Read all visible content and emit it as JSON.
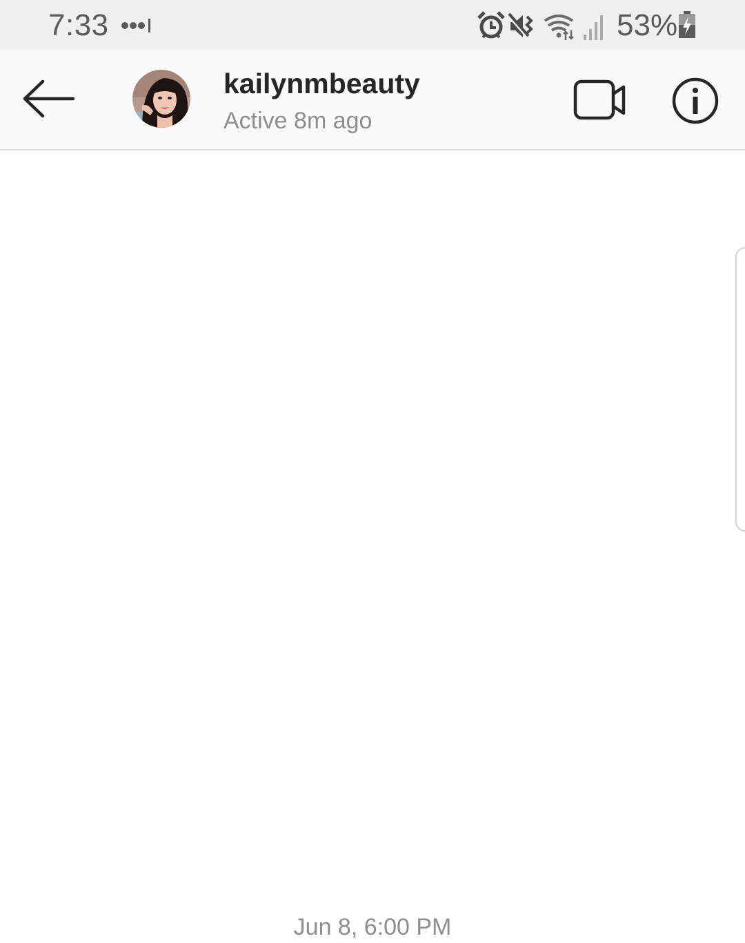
{
  "status_bar": {
    "time": "7:33",
    "battery_percent_text": "53%",
    "icons": [
      "more-dots-icon",
      "alarm-icon",
      "mute-vibrate-icon",
      "wifi-icon",
      "signal-icon",
      "battery-charging-icon"
    ]
  },
  "header": {
    "username": "kailynmbeauty",
    "status": "Active 8m ago",
    "icons": [
      "back-arrow-icon",
      "avatar",
      "video-call-icon",
      "info-icon"
    ]
  },
  "conversation": {
    "timestamp": "Jun 8, 6:00 PM"
  },
  "colors": {
    "status_bar_bg": "#efefef",
    "header_bg": "#fafafa",
    "text_primary": "#262626",
    "text_secondary": "#8e8e8e"
  }
}
